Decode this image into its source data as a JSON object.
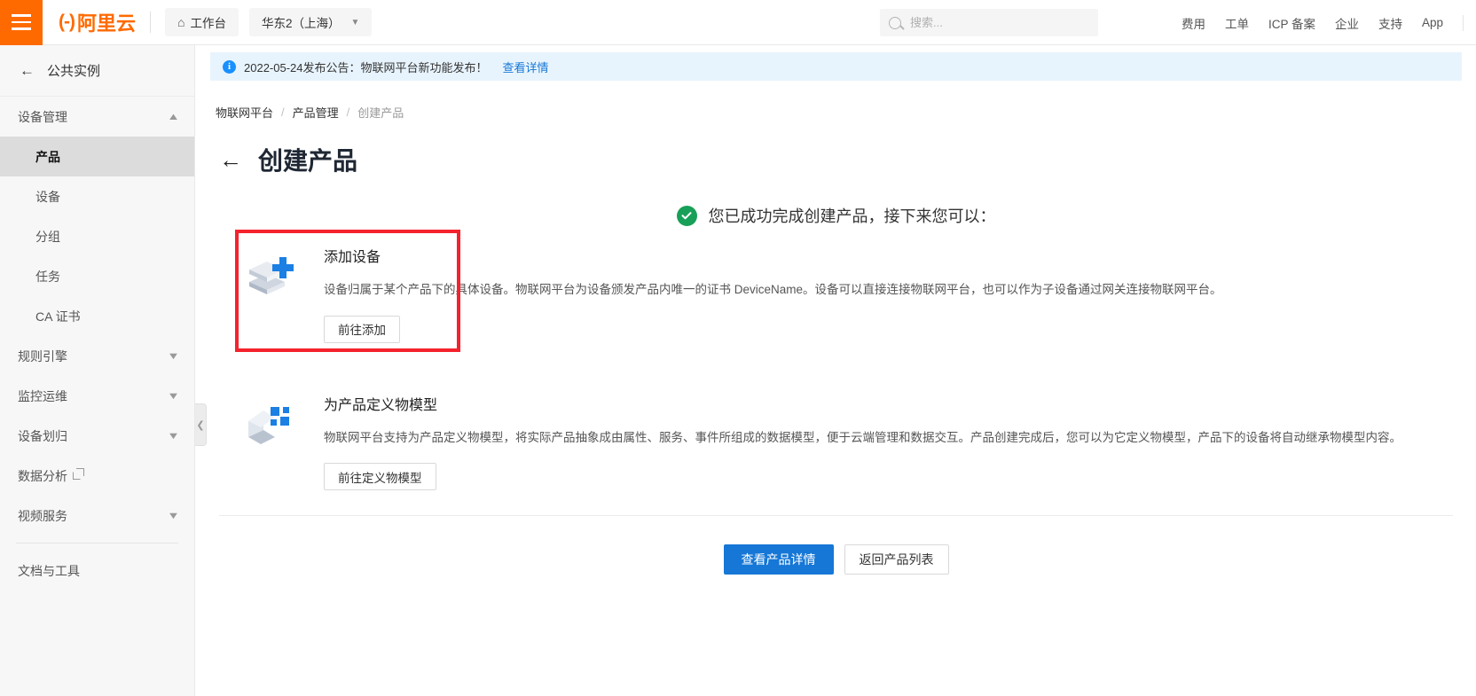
{
  "header": {
    "menu_icon": "hamburger-icon",
    "logo_mark": "(-)",
    "logo_text": "阿里云",
    "workbench": "工作台",
    "home_icon": "home-icon",
    "region": "华东2（上海）",
    "region_caret": "chevron-down-icon",
    "search": {
      "placeholder": "搜索...",
      "value": "",
      "icon": "search-icon"
    },
    "links": [
      "费用",
      "工单",
      "ICP 备案",
      "企业",
      "支持",
      "App"
    ]
  },
  "sidebar": {
    "back_label": "公共实例",
    "back_icon": "arrow-left-icon",
    "groups": [
      {
        "label": "设备管理",
        "caret": "chevron-up-icon",
        "expanded": true,
        "items": [
          {
            "label": "产品",
            "active": true
          },
          {
            "label": "设备",
            "active": false
          },
          {
            "label": "分组",
            "active": false
          },
          {
            "label": "任务",
            "active": false
          },
          {
            "label": "CA 证书",
            "active": false
          }
        ]
      },
      {
        "label": "规则引擎",
        "caret": "chevron-down-icon",
        "expanded": false,
        "items": []
      },
      {
        "label": "监控运维",
        "caret": "chevron-down-icon",
        "expanded": false,
        "items": []
      },
      {
        "label": "设备划归",
        "caret": "chevron-down-icon",
        "expanded": false,
        "items": []
      }
    ],
    "data_analysis": {
      "label": "数据分析",
      "external_icon": "external-link-icon"
    },
    "video_service": {
      "label": "视频服务",
      "caret": "chevron-down-icon"
    },
    "docs_tools": "文档与工具",
    "collapse_icon": "chevron-left-icon"
  },
  "notice": {
    "icon": "info-icon",
    "text": "2022-05-24发布公告：物联网平台新功能发布！",
    "link": "查看详情"
  },
  "breadcrumb": {
    "items": [
      "物联网平台",
      "产品管理",
      "创建产品"
    ],
    "separator": "/"
  },
  "page": {
    "back_icon": "arrow-left-icon",
    "title": "创建产品",
    "success_icon": "check-circle-icon",
    "success_text": "您已成功完成创建产品，接下来您可以："
  },
  "cards": [
    {
      "icon": "layers-plus-icon",
      "title": "添加设备",
      "description": "设备归属于某个产品下的具体设备。物联网平台为设备颁发产品内唯一的证书 DeviceName。设备可以直接连接物联网平台，也可以作为子设备通过网关连接物联网平台。",
      "button": "前往添加",
      "highlighted": true
    },
    {
      "icon": "cube-blocks-icon",
      "title": "为产品定义物模型",
      "description": "物联网平台支持为产品定义物模型，将实际产品抽象成由属性、服务、事件所组成的数据模型，便于云端管理和数据交互。产品创建完成后，您可以为它定义物模型，产品下的设备将自动继承物模型内容。",
      "button": "前往定义物模型",
      "highlighted": false
    }
  ],
  "footer": {
    "primary_button": "查看产品详情",
    "secondary_button": "返回产品列表"
  },
  "colors": {
    "brand_orange": "#ff6a00",
    "link_blue": "#1677d6",
    "success_green": "#18a058",
    "highlight_red": "#f5222d",
    "notice_bg": "#e8f4fd"
  }
}
